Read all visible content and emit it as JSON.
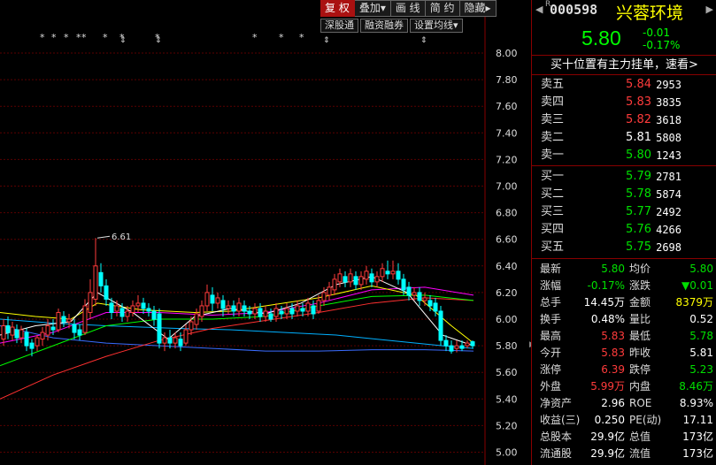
{
  "toolbar": {
    "buttons": [
      "复 权",
      "叠加▾",
      "画 线",
      "简 约",
      "隐藏▸"
    ],
    "sub_buttons": [
      "深股通",
      "融资融券",
      "设置均线▾"
    ]
  },
  "stock": {
    "r_mark": "R",
    "code": "000598",
    "name": "兴蓉环境",
    "price": "5.80",
    "change": "-0.01",
    "change_pct": "-0.17%",
    "promo": "买十位置有主力挂单，速看>"
  },
  "orderbook": {
    "asks": [
      {
        "label": "卖五",
        "price": "5.84",
        "vol": "2953",
        "color": "red"
      },
      {
        "label": "卖四",
        "price": "5.83",
        "vol": "3835",
        "color": "red"
      },
      {
        "label": "卖三",
        "price": "5.82",
        "vol": "3618",
        "color": "red"
      },
      {
        "label": "卖二",
        "price": "5.81",
        "vol": "5808",
        "color": "white"
      },
      {
        "label": "卖一",
        "price": "5.80",
        "vol": "1243",
        "color": "green"
      }
    ],
    "bids": [
      {
        "label": "买一",
        "price": "5.79",
        "vol": "2781",
        "color": "green"
      },
      {
        "label": "买二",
        "price": "5.78",
        "vol": "5874",
        "color": "green"
      },
      {
        "label": "买三",
        "price": "5.77",
        "vol": "2492",
        "color": "green"
      },
      {
        "label": "买四",
        "price": "5.76",
        "vol": "4266",
        "color": "green"
      },
      {
        "label": "买五",
        "price": "5.75",
        "vol": "2698",
        "color": "green"
      }
    ]
  },
  "stats": [
    {
      "l1": "最新",
      "v1": "5.80",
      "c1": "green",
      "l2": "均价",
      "v2": "5.80",
      "c2": "green"
    },
    {
      "l1": "涨幅",
      "v1": "-0.17%",
      "c1": "green",
      "l2": "涨跌",
      "v2": "▼0.01",
      "c2": "green"
    },
    {
      "l1": "总手",
      "v1": "14.45万",
      "c1": "white",
      "l2": "金额",
      "v2": "8379万",
      "c2": "yellow"
    },
    {
      "l1": "换手",
      "v1": "0.48%",
      "c1": "white",
      "l2": "量比",
      "v2": "0.52",
      "c2": "white"
    },
    {
      "l1": "最高",
      "v1": "5.83",
      "c1": "red",
      "l2": "最低",
      "v2": "5.78",
      "c2": "green"
    },
    {
      "l1": "今开",
      "v1": "5.83",
      "c1": "red",
      "l2": "昨收",
      "v2": "5.81",
      "c2": "white"
    },
    {
      "l1": "涨停",
      "v1": "6.39",
      "c1": "red",
      "l2": "跌停",
      "v2": "5.23",
      "c2": "green"
    },
    {
      "l1": "外盘",
      "v1": "5.99万",
      "c1": "red",
      "l2": "内盘",
      "v2": "8.46万",
      "c2": "green"
    },
    {
      "l1": "净资产",
      "v1": "2.96",
      "c1": "white",
      "l2": "ROE",
      "v2": "8.93%",
      "c2": "white"
    },
    {
      "l1": "收益(三)",
      "v1": "0.250",
      "c1": "white",
      "l2": "PE(动)",
      "v2": "17.11",
      "c2": "white"
    },
    {
      "l1": "总股本",
      "v1": "29.9亿",
      "c1": "white",
      "l2": "总值",
      "v2": "173亿",
      "c2": "white"
    },
    {
      "l1": "流通股",
      "v1": "29.9亿",
      "c1": "white",
      "l2": "流值",
      "v2": "173亿",
      "c2": "white"
    }
  ],
  "chart": {
    "y_axis": [
      "8.00",
      "7.80",
      "7.60",
      "7.40",
      "7.20",
      "7.00",
      "6.80",
      "6.60",
      "6.40",
      "6.20",
      "6.00",
      "5.80",
      "5.60",
      "5.40",
      "5.20",
      "5.00"
    ],
    "high_label": "6.61",
    "markers": [
      "*",
      "*",
      "*",
      "*",
      "*",
      "*",
      "*",
      "*",
      "*",
      "*",
      "*"
    ]
  },
  "colors": {
    "up": "#ff3b3b",
    "down": "#00ffff",
    "ma5": "#ffffff",
    "ma10": "#ffff00",
    "ma20": "#ff00ff",
    "ma30": "#00ff00",
    "ma60": "#ff3030",
    "ma120": "#3a6cff",
    "ma250": "#00b0ff"
  }
}
